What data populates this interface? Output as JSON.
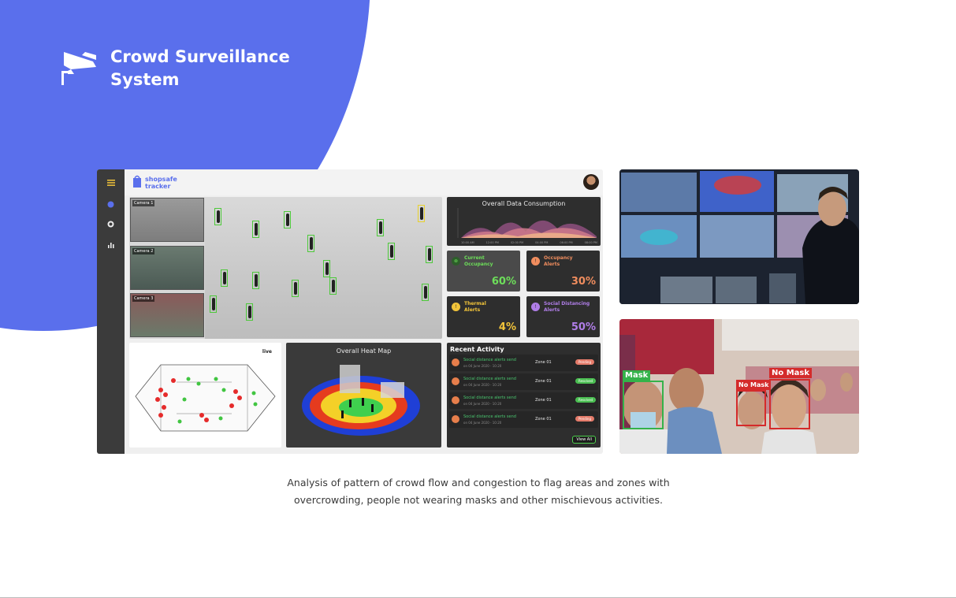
{
  "brand": {
    "title": "Crowd Surveillance System",
    "icon": "cctv-camera-icon"
  },
  "dashboard": {
    "logo": {
      "line1": "shopsafe",
      "line2": "tracker"
    },
    "sidebar_icons": [
      "hamburger-menu-icon",
      "dot-icon",
      "gear-icon",
      "bar-chart-icon"
    ],
    "cameras": [
      {
        "label": "Camera 1"
      },
      {
        "label": "Camera 2"
      },
      {
        "label": "Camera 3"
      }
    ],
    "consumption": {
      "title": "Overall Data Consumption",
      "x_ticks": [
        "10:00 AM",
        "12:00 PM",
        "02:00 PM",
        "04:00 PM",
        "06:00 PM",
        "08:00 PM"
      ]
    },
    "stats": [
      {
        "name_line1": "Current",
        "name_line2": "Occupancy",
        "value": "60%",
        "color": "#6ddf5a"
      },
      {
        "name_line1": "Occupancy",
        "name_line2": "Alerts",
        "value": "30%",
        "color": "#f08d5e"
      },
      {
        "name_line1": "Thermal",
        "name_line2": "Alerts",
        "value": "4%",
        "color": "#f2c43a"
      },
      {
        "name_line1": "Social Distancing",
        "name_line2": "Alerts",
        "value": "50%",
        "color": "#b07ee8"
      }
    ],
    "floor_plan": {
      "live_label": "live"
    },
    "heat_map": {
      "title": "Overall Heat Map"
    },
    "activity": {
      "title": "Recent Activity",
      "rows": [
        {
          "text": "Social distance alerts send",
          "date": "on 04 June 2020 - 10:20",
          "zone": "Zone 01",
          "status": "Pending",
          "status_color": "#e47b6a"
        },
        {
          "text": "Social distance alerts send",
          "date": "on 04 June 2020 - 10:20",
          "zone": "Zone 01",
          "status": "Resolved",
          "status_color": "#4bbf52"
        },
        {
          "text": "Social distance alerts send",
          "date": "on 04 June 2020 - 10:20",
          "zone": "Zone 01",
          "status": "Resolved",
          "status_color": "#4bbf52"
        },
        {
          "text": "Social distance alerts send",
          "date": "on 04 June 2020 - 10:20",
          "zone": "Zone 01",
          "status": "Pending",
          "status_color": "#e47b6a"
        }
      ],
      "view_all": "View All"
    }
  },
  "mask_photo": {
    "labels": [
      "Mask",
      "No Mask",
      "No Mask"
    ]
  },
  "caption": {
    "line1": "Analysis of pattern of crowd flow and congestion to flag areas and zones with",
    "line2": "overcrowding, people not wearing masks and other mischievous activities."
  },
  "colors": {
    "accent": "#5a6fec",
    "panel_dark": "#2e2e2e"
  }
}
